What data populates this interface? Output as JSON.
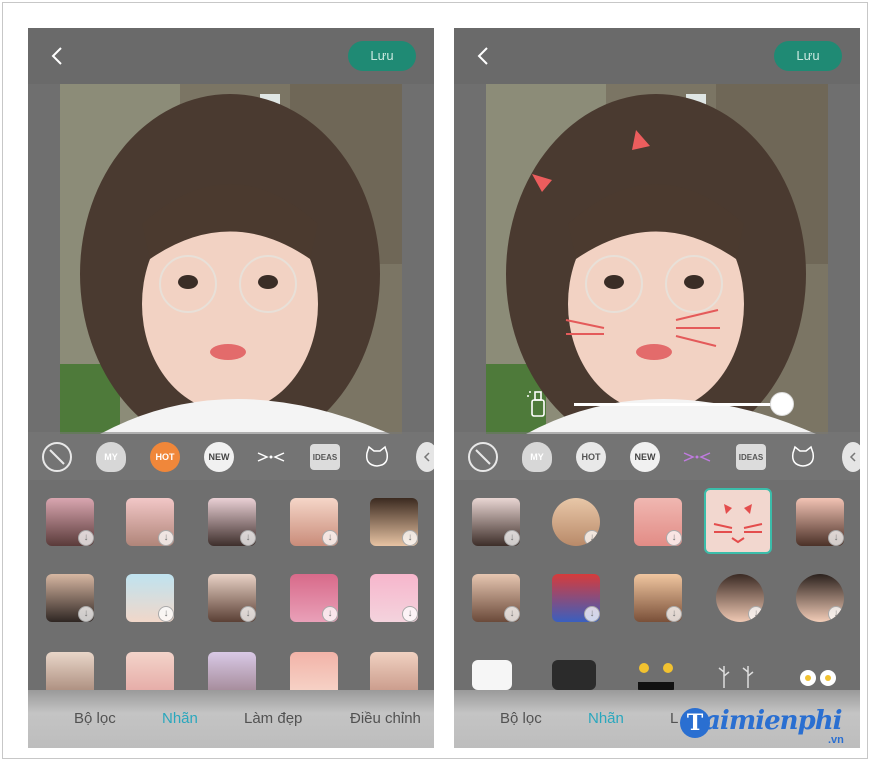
{
  "screens": [
    {
      "save_label": "Lưu",
      "categories": [
        {
          "label": "",
          "icon": "no-sticker-icon"
        },
        {
          "label": "MY",
          "icon": "heart-badge-icon"
        },
        {
          "label": "HOT",
          "icon": "hot-badge-icon",
          "active": true
        },
        {
          "label": "NEW",
          "icon": "new-badge-icon"
        },
        {
          "label": "",
          "icon": "whiskers-icon"
        },
        {
          "label": "IDEAS",
          "icon": "ideas-badge-icon"
        },
        {
          "label": "",
          "icon": "cat-face-icon"
        },
        {
          "label": "",
          "icon": "more-icon"
        }
      ],
      "tabs": [
        {
          "label": "Bộ lọc"
        },
        {
          "label": "Nhãn",
          "active": true
        },
        {
          "label": "Làm đẹp"
        },
        {
          "label": "Điều chỉnh"
        }
      ]
    },
    {
      "save_label": "Lưu",
      "categories": [
        {
          "label": "",
          "icon": "no-sticker-icon"
        },
        {
          "label": "MY",
          "icon": "heart-badge-icon"
        },
        {
          "label": "HOT",
          "icon": "hot-badge-icon"
        },
        {
          "label": "NEW",
          "icon": "new-badge-icon"
        },
        {
          "label": "",
          "icon": "whiskers-icon",
          "active": true
        },
        {
          "label": "IDEAS",
          "icon": "ideas-badge-icon"
        },
        {
          "label": "",
          "icon": "cat-face-icon"
        },
        {
          "label": "",
          "icon": "more-icon"
        }
      ],
      "slider": {
        "value": 1.0
      },
      "tabs": [
        {
          "label": "Bộ lọc"
        },
        {
          "label": "Nhãn",
          "active": true
        },
        {
          "label": "L"
        }
      ]
    }
  ],
  "watermark": {
    "brand": "aimienphi",
    "initial": "T",
    "suffix": ".vn"
  },
  "colors": {
    "accent": "#2aa7bd",
    "save_button": "#1f8a74",
    "hot_badge": "#f0873a",
    "selected_border": "#3bbdaa"
  }
}
